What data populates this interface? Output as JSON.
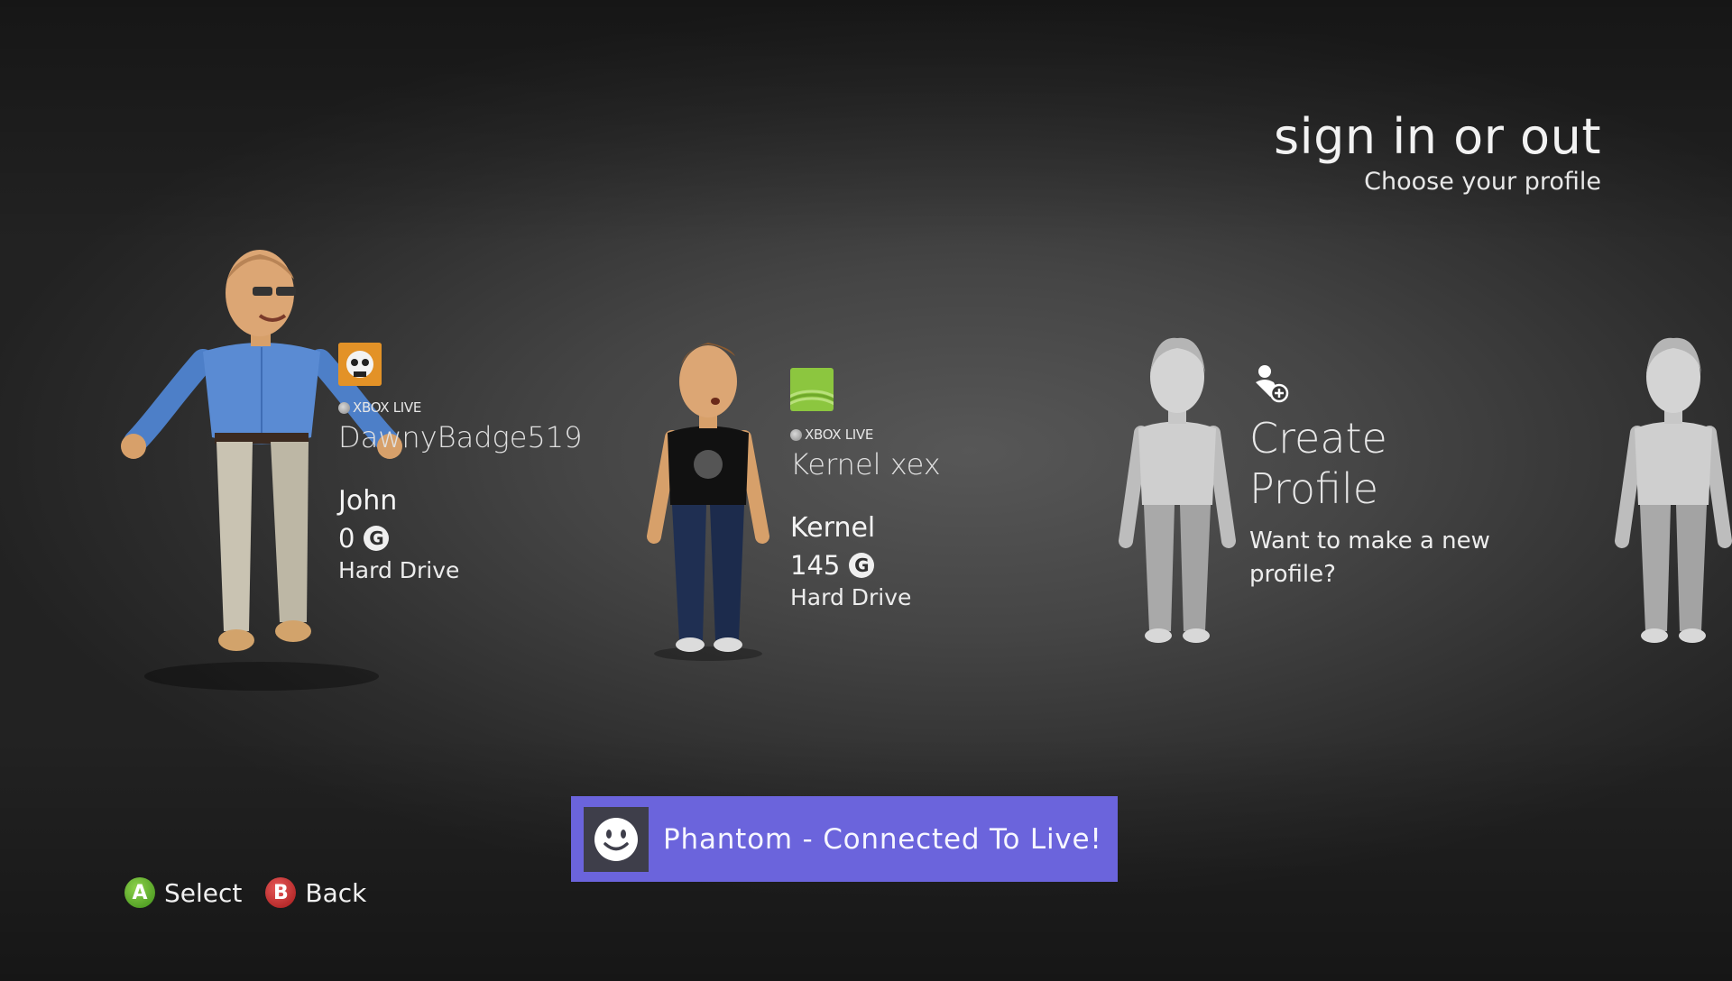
{
  "header": {
    "title": "sign in or out",
    "subtitle": "Choose your profile"
  },
  "profiles": [
    {
      "live_label": "XBOX LIVE",
      "gamertag": "DawnyBadge519",
      "name": "John",
      "gamerscore": "0",
      "storage": "Hard Drive",
      "gamerpic_icon": "skull-gamerpic-icon"
    },
    {
      "live_label": "XBOX LIVE",
      "gamertag": "Kernel xex",
      "name": "Kernel",
      "gamerscore": "145",
      "storage": "Hard Drive",
      "gamerpic_icon": "green-wave-gamerpic-icon"
    }
  ],
  "create_profile": {
    "title_line1": "Create",
    "title_line2": "Profile",
    "description": "Want to make a new profile?",
    "icon": "add-person-icon"
  },
  "gamerscore_glyph": "G",
  "notification": {
    "text": "Phantom - Connected To Live!",
    "icon": "smiley-icon"
  },
  "hints": {
    "a_glyph": "A",
    "a_label": "Select",
    "b_glyph": "B",
    "b_label": "Back"
  },
  "colors": {
    "toast_background": "#6b64dc",
    "a_button": "#4fa61f",
    "b_button": "#c42525"
  }
}
